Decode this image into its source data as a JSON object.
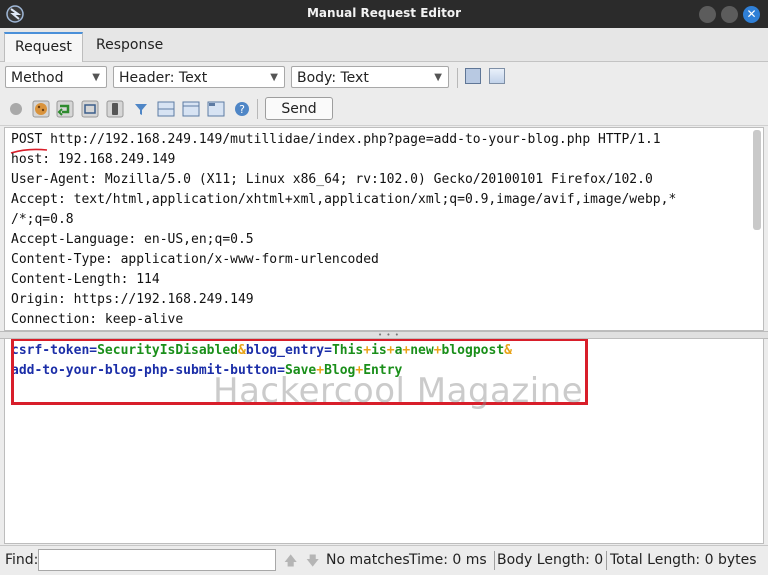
{
  "window": {
    "title": "Manual Request Editor",
    "close_glyph": "✕"
  },
  "tabs": [
    {
      "label": "Request"
    },
    {
      "label": "Response"
    }
  ],
  "toolbar": {
    "method_select": "Method",
    "header_select": "Header: Text",
    "body_select": "Body: Text",
    "send_label": "Send",
    "icons": [
      "status-dot-icon",
      "cookie-icon",
      "redirect-icon",
      "fullscreen-icon",
      "device-icon",
      "filter-icon",
      "split-horizontal-icon",
      "split-vertical-icon",
      "tabs-icon",
      "help-icon"
    ]
  },
  "request": {
    "headers": [
      "POST http://192.168.249.149/mutillidae/index.php?page=add-to-your-blog.php HTTP/1.1",
      "host: 192.168.249.149",
      "User-Agent: Mozilla/5.0 (X11; Linux x86_64; rv:102.0) Gecko/20100101 Firefox/102.0",
      "Accept: text/html,application/xhtml+xml,application/xml;q=0.9,image/avif,image/webp,*",
      "/*;q=0.8",
      "Accept-Language: en-US,en;q=0.5",
      "Content-Type: application/x-www-form-urlencoded",
      "Content-Length: 114",
      "Origin: https://192.168.249.149",
      "Connection: keep-alive"
    ],
    "body": {
      "line1": [
        {
          "t": "csrf-token",
          "c": "k"
        },
        {
          "t": "=",
          "c": "e"
        },
        {
          "t": "SecurityIsDisabled",
          "c": "v"
        },
        {
          "t": "&",
          "c": "a"
        },
        {
          "t": "blog_entry",
          "c": "k"
        },
        {
          "t": "=",
          "c": "e"
        },
        {
          "t": "This",
          "c": "v"
        },
        {
          "t": "+",
          "c": "a"
        },
        {
          "t": "is",
          "c": "v"
        },
        {
          "t": "+",
          "c": "a"
        },
        {
          "t": "a",
          "c": "v"
        },
        {
          "t": "+",
          "c": "a"
        },
        {
          "t": "new",
          "c": "v"
        },
        {
          "t": "+",
          "c": "a"
        },
        {
          "t": "blogpost",
          "c": "v"
        },
        {
          "t": "&",
          "c": "a"
        }
      ],
      "line2": [
        {
          "t": "add-to-your-blog-php-submit-button",
          "c": "k"
        },
        {
          "t": "=",
          "c": "e"
        },
        {
          "t": "Save",
          "c": "v"
        },
        {
          "t": "+",
          "c": "a"
        },
        {
          "t": "Blog",
          "c": "v"
        },
        {
          "t": "+",
          "c": "a"
        },
        {
          "t": "Entry",
          "c": "v"
        }
      ]
    }
  },
  "watermark": "Hackercool Magazine",
  "status": {
    "find_label": "Find:",
    "find_value": "",
    "up_arrow": "🡅",
    "down_arrow": "🡇",
    "no_matches": "No matches",
    "time": "Time: 0 ms",
    "body_length": "Body Length: 0",
    "total_length": "Total Length: 0 bytes"
  },
  "colors": {
    "highlight_box": "#d81e2a",
    "key": "#1b2ea8",
    "value": "#1a8f1a",
    "separator": "#e8a317"
  }
}
